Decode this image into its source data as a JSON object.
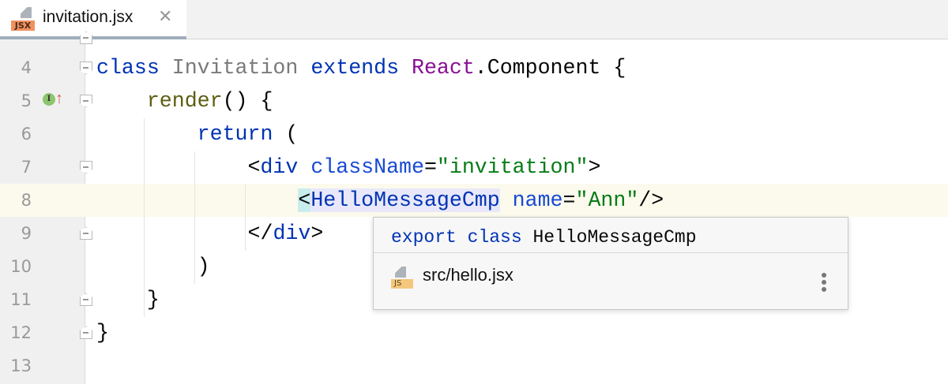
{
  "tab": {
    "filename": "invitation.jsx",
    "icon_label": "JSX",
    "close": "✕"
  },
  "gutter": {
    "implements_marker": "I"
  },
  "code_lines": [
    {
      "num": "4",
      "tokens": [
        [
          "class ",
          "kw"
        ],
        [
          "Invitation ",
          "cls"
        ],
        [
          "extends ",
          "kw"
        ],
        [
          "React",
          "rc"
        ],
        [
          ".Component {",
          ""
        ]
      ]
    },
    {
      "num": "5",
      "tokens": [
        [
          "    ",
          ""
        ],
        [
          "render",
          "fn"
        ],
        [
          "() {",
          ""
        ]
      ]
    },
    {
      "num": "6",
      "tokens": [
        [
          "        ",
          ""
        ],
        [
          "return ",
          "kw"
        ],
        [
          "(",
          ""
        ]
      ]
    },
    {
      "num": "7",
      "tokens": [
        [
          "            <",
          ""
        ],
        [
          "div ",
          "tag"
        ],
        [
          "className",
          "attr"
        ],
        [
          "=",
          ""
        ],
        [
          "\"invitation\"",
          "str"
        ],
        [
          ">",
          ""
        ]
      ]
    },
    {
      "num": "8",
      "tokens": [
        [
          "                ",
          ""
        ],
        [
          "<",
          "br"
        ],
        [
          "HelloMessageCmp",
          "tag hl"
        ],
        [
          " ",
          ""
        ],
        [
          "name",
          "attr"
        ],
        [
          "=",
          ""
        ],
        [
          "\"Ann\"",
          "str"
        ],
        [
          "/>",
          ""
        ]
      ]
    },
    {
      "num": "9",
      "tokens": [
        [
          "            </",
          ""
        ],
        [
          "div",
          "tag"
        ],
        [
          ">",
          ""
        ]
      ]
    },
    {
      "num": "10",
      "tokens": [
        [
          "        )",
          ""
        ]
      ]
    },
    {
      "num": "11",
      "tokens": [
        [
          "    }",
          ""
        ]
      ]
    },
    {
      "num": "12",
      "tokens": [
        [
          "}",
          ""
        ]
      ]
    },
    {
      "num": "13",
      "tokens": []
    }
  ],
  "popup": {
    "signature_keyword1": "export",
    "signature_keyword2": "class",
    "signature_name": "HelloMessageCmp",
    "file_icon_label": "JS",
    "file_path": "src/hello.jsx"
  }
}
